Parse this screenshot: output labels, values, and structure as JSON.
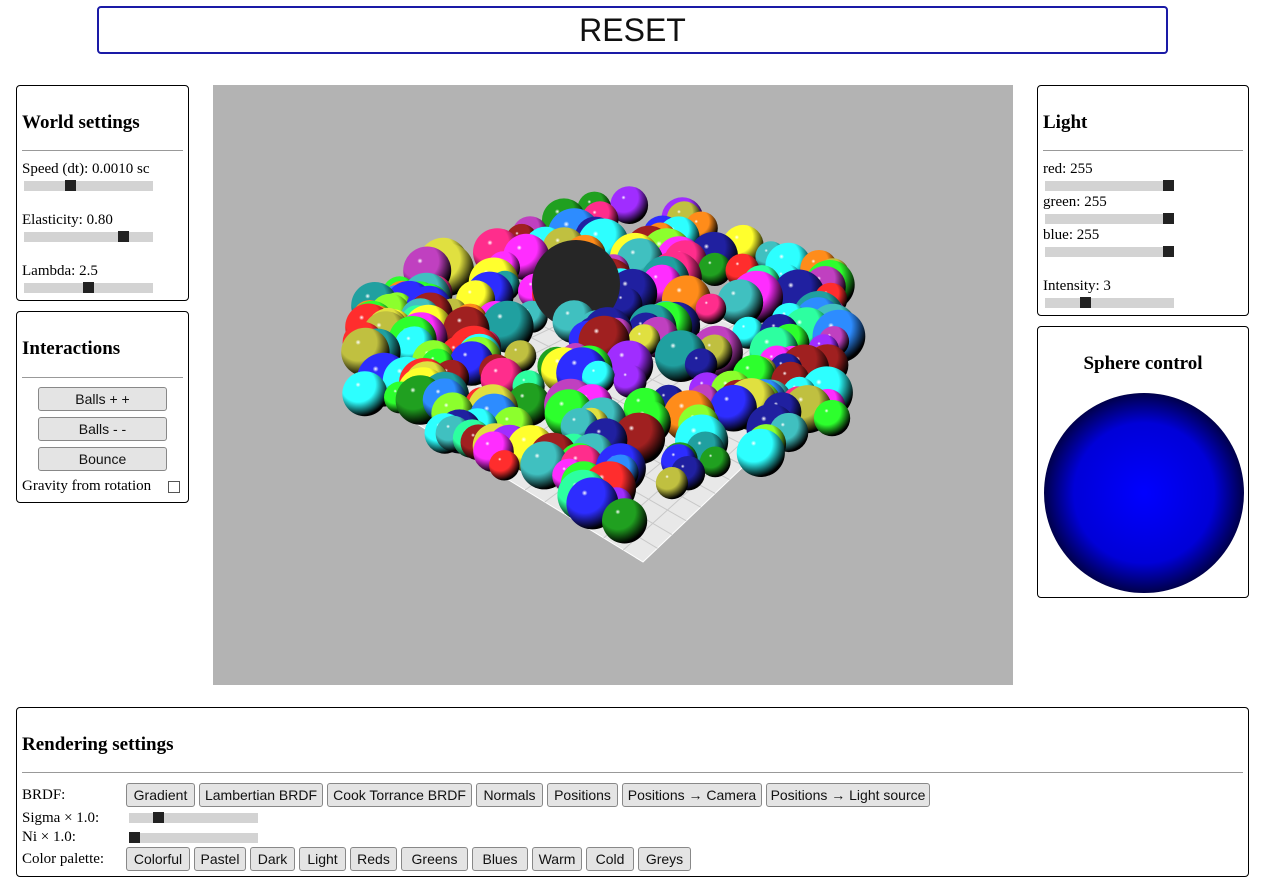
{
  "reset_label": "RESET",
  "world": {
    "title": "World settings",
    "speed_label": "Speed (dt): 0.0010 sc",
    "speed_value": 0.35,
    "elasticity_label": "Elasticity: 0.80",
    "elasticity_value": 0.8,
    "lambda_label": "Lambda: 2.5",
    "lambda_value": 0.5
  },
  "interactions": {
    "title": "Interactions",
    "balls_plus": "Balls + +",
    "balls_minus": "Balls - -",
    "bounce": "Bounce",
    "gravity_label": "Gravity from rotation",
    "gravity_checked": false
  },
  "light": {
    "title": "Light",
    "red_label": "red: 255",
    "red_value": 1.0,
    "green_label": "green: 255",
    "green_value": 1.0,
    "blue_label": "blue: 255",
    "blue_value": 1.0,
    "intensity_label": "Intensity: 3",
    "intensity_value": 0.3
  },
  "sphere_control": {
    "title": "Sphere control",
    "color": "#0000ff"
  },
  "rendering": {
    "title": "Rendering settings",
    "brdf_label": "BRDF:",
    "brdf_options": [
      "Gradient",
      "Lambertian BRDF",
      "Cook Torrance BRDF",
      "Normals",
      "Positions",
      "Positions → Camera",
      "Positions → Light source"
    ],
    "sigma_label": "Sigma × 1.0:",
    "sigma_value": 0.2,
    "ni_label": "Ni × 1.0:",
    "ni_value": 0.0,
    "palette_label": "Color palette:",
    "palette_options": [
      "Colorful",
      "Pastel",
      "Dark",
      "Light",
      "Reds",
      "Greens",
      "Blues",
      "Warm",
      "Cold",
      "Greys"
    ]
  },
  "scene": {
    "background": "#b3b3b3",
    "floor_color": "#e8e8e8"
  }
}
